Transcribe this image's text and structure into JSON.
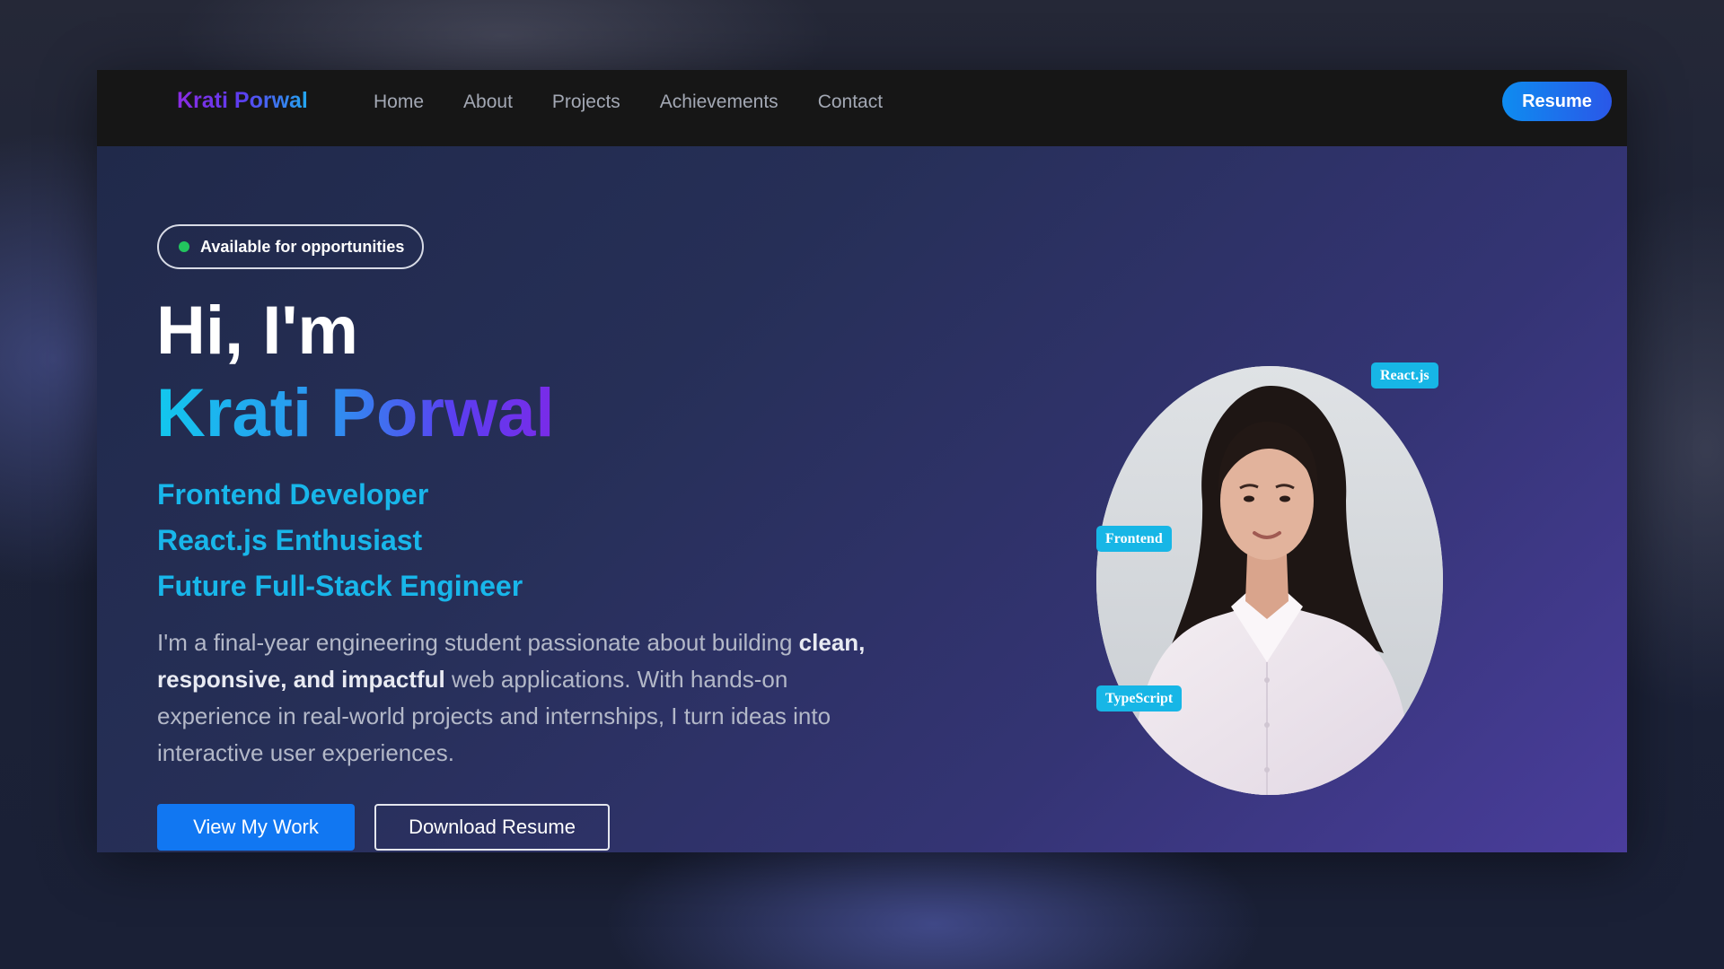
{
  "navbar": {
    "brand": "Krati Porwal",
    "links": [
      "Home",
      "About",
      "Projects",
      "Achievements",
      "Contact"
    ],
    "resume_label": "Resume"
  },
  "hero": {
    "badge": "Available for opportunities",
    "greeting": "Hi, I'm",
    "name": "Krati Porwal",
    "roles": [
      "Frontend Developer",
      "React.js Enthusiast",
      "Future Full-Stack Engineer"
    ],
    "description": {
      "part1": "I'm a final-year engineering student passionate about building ",
      "bold": "clean, responsive, and impactful",
      "part2": " web applications. With hands-on experience in real-world projects and internships, I turn ideas into interactive user experiences."
    },
    "primary_button": "View My Work",
    "secondary_button": "Download Resume"
  },
  "profile": {
    "tags": {
      "react": "React.js",
      "frontend": "Frontend",
      "typescript": "TypeScript"
    }
  },
  "colors": {
    "accent_cyan": "#18b6ea",
    "accent_blue": "#1177f2",
    "accent_purple": "#5b3ef0",
    "status_green": "#22c55e",
    "navbar_bg": "#161616"
  }
}
